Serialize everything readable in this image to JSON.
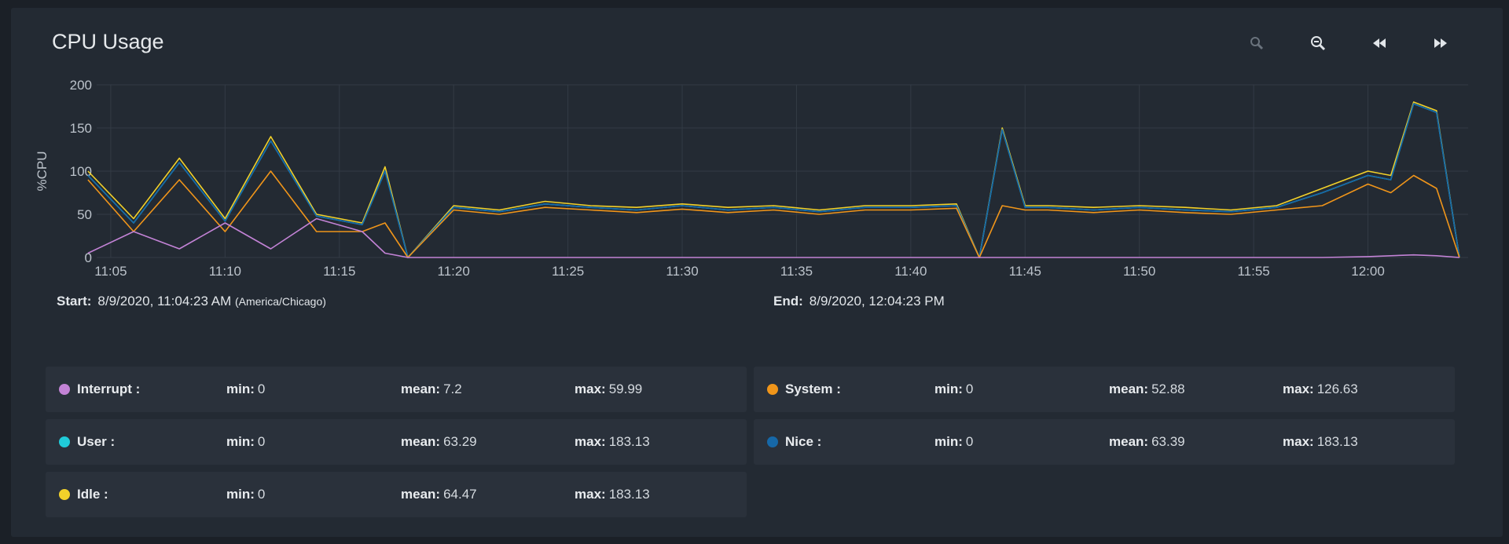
{
  "title": "CPU Usage",
  "toolbar": [
    {
      "name": "zoom-in-icon",
      "label": "zoom in"
    },
    {
      "name": "zoom-out-icon",
      "label": "zoom out"
    },
    {
      "name": "rewind-icon",
      "label": "rewind"
    },
    {
      "name": "fast-forward-icon",
      "label": "fast forward"
    }
  ],
  "range": {
    "start_label": "Start:",
    "start_value": "8/9/2020, 11:04:23 AM",
    "start_tz": "(America/Chicago)",
    "end_label": "End:",
    "end_value": "8/9/2020, 12:04:23 PM"
  },
  "colors": {
    "interrupt": "#c383d6",
    "system": "#f0951a",
    "user": "#20cbd9",
    "nice": "#1668a8",
    "idle": "#f2d12a",
    "grid": "#333b45",
    "axis": "#bcc3cb"
  },
  "legend": [
    {
      "key": "interrupt",
      "name": "Interrupt :",
      "min": "0",
      "mean": "7.2",
      "max": "59.99"
    },
    {
      "key": "system",
      "name": "System :",
      "min": "0",
      "mean": "52.88",
      "max": "126.63"
    },
    {
      "key": "user",
      "name": "User :",
      "min": "0",
      "mean": "63.29",
      "max": "183.13"
    },
    {
      "key": "nice",
      "name": "Nice :",
      "min": "0",
      "mean": "63.39",
      "max": "183.13"
    },
    {
      "key": "idle",
      "name": "Idle :",
      "min": "0",
      "mean": "64.47",
      "max": "183.13"
    }
  ],
  "stat_labels": {
    "min": "min:",
    "mean": "mean:",
    "max": "max:"
  },
  "chart_data": {
    "type": "line",
    "ylabel": "%CPU",
    "ylim": [
      0,
      200
    ],
    "yticks": [
      0,
      50,
      100,
      150,
      200
    ],
    "xlim": [
      "11:04:23",
      "12:04:23"
    ],
    "xticks": [
      "11:05",
      "11:10",
      "11:15",
      "11:20",
      "11:25",
      "11:30",
      "11:35",
      "11:40",
      "11:45",
      "11:50",
      "11:55",
      "12:00"
    ],
    "x": [
      "11:04",
      "11:06",
      "11:08",
      "11:10",
      "11:12",
      "11:14",
      "11:16",
      "11:17",
      "11:18",
      "11:20",
      "11:22",
      "11:24",
      "11:26",
      "11:28",
      "11:30",
      "11:32",
      "11:34",
      "11:36",
      "11:38",
      "11:40",
      "11:42",
      "11:43",
      "11:44",
      "11:45",
      "11:46",
      "11:48",
      "11:50",
      "11:52",
      "11:54",
      "11:56",
      "11:58",
      "12:00",
      "12:01",
      "12:02",
      "12:03",
      "12:04"
    ],
    "series": [
      {
        "name": "Idle",
        "color_key": "idle",
        "values": [
          100,
          45,
          115,
          45,
          140,
          50,
          40,
          105,
          0,
          60,
          55,
          65,
          60,
          58,
          62,
          58,
          60,
          55,
          60,
          60,
          62,
          0,
          150,
          60,
          60,
          58,
          60,
          58,
          55,
          60,
          80,
          100,
          95,
          180,
          170,
          0
        ]
      },
      {
        "name": "User",
        "color_key": "user",
        "values": [
          95,
          40,
          110,
          42,
          135,
          48,
          38,
          100,
          0,
          58,
          53,
          62,
          58,
          55,
          60,
          55,
          58,
          53,
          58,
          58,
          60,
          0,
          148,
          58,
          58,
          55,
          58,
          55,
          53,
          58,
          75,
          95,
          90,
          178,
          168,
          0
        ]
      },
      {
        "name": "Nice",
        "color_key": "nice",
        "values": [
          95,
          40,
          110,
          42,
          135,
          48,
          38,
          100,
          0,
          58,
          53,
          62,
          58,
          55,
          60,
          55,
          58,
          53,
          58,
          58,
          60,
          0,
          148,
          58,
          58,
          55,
          58,
          55,
          53,
          58,
          75,
          95,
          90,
          178,
          168,
          0
        ]
      },
      {
        "name": "System",
        "color_key": "system",
        "values": [
          90,
          30,
          90,
          30,
          100,
          30,
          30,
          40,
          0,
          55,
          50,
          58,
          55,
          52,
          56,
          52,
          55,
          50,
          55,
          55,
          57,
          0,
          60,
          55,
          55,
          52,
          55,
          52,
          50,
          55,
          60,
          85,
          75,
          95,
          80,
          0
        ]
      },
      {
        "name": "Interrupt",
        "color_key": "interrupt",
        "values": [
          5,
          30,
          10,
          40,
          10,
          45,
          30,
          5,
          0,
          0,
          0,
          0,
          0,
          0,
          0,
          0,
          0,
          0,
          0,
          0,
          0,
          0,
          0,
          0,
          0,
          0,
          0,
          0,
          0,
          0,
          0,
          1,
          2,
          3,
          2,
          0
        ]
      }
    ]
  }
}
